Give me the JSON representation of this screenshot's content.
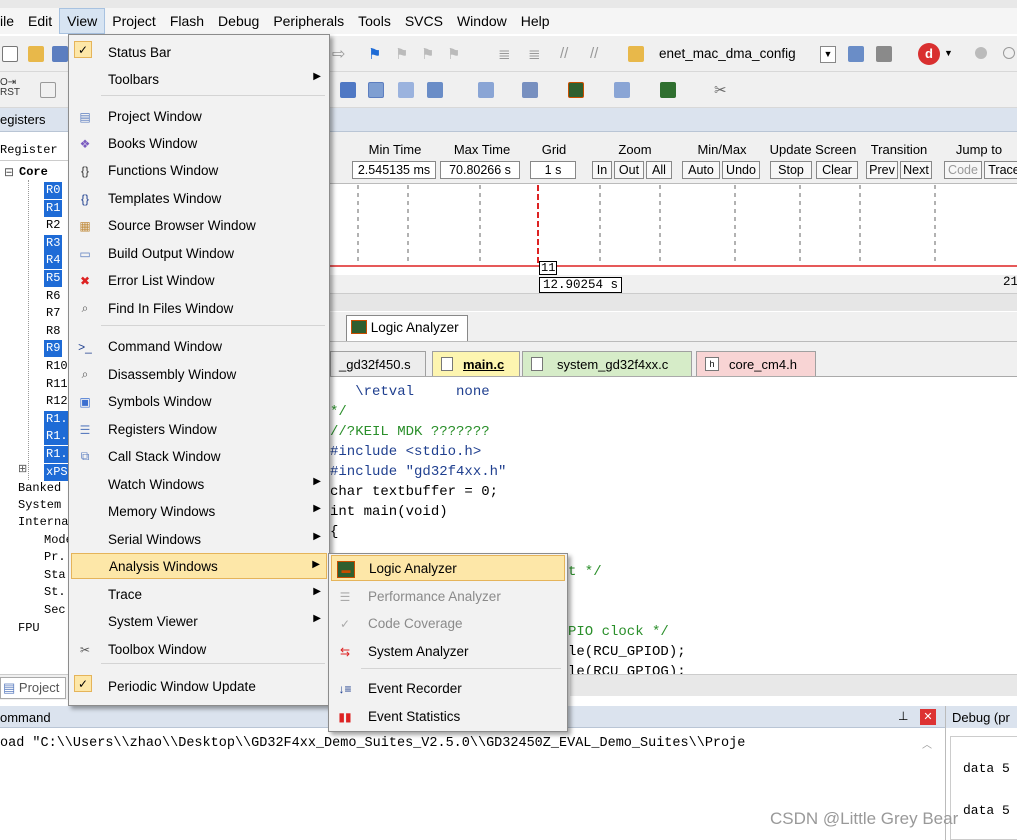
{
  "menubar": {
    "items": [
      "ile",
      "Edit",
      "View",
      "Project",
      "Flash",
      "Debug",
      "Peripherals",
      "Tools",
      "SVCS",
      "Window",
      "Help"
    ]
  },
  "toolbar": {
    "target_name": "enet_mac_dma_config"
  },
  "registers": {
    "panel_title": "egisters",
    "col_header": "Register",
    "core_label": "Core",
    "items": [
      {
        "name": "R0",
        "selected": true
      },
      {
        "name": "R1",
        "selected": true
      },
      {
        "name": "R2",
        "selected": false
      },
      {
        "name": "R3",
        "selected": true
      },
      {
        "name": "R4",
        "selected": true
      },
      {
        "name": "R5",
        "selected": true
      },
      {
        "name": "R6",
        "selected": false
      },
      {
        "name": "R7",
        "selected": false
      },
      {
        "name": "R8",
        "selected": false
      },
      {
        "name": "R9",
        "selected": true
      },
      {
        "name": "R10",
        "selected": false
      },
      {
        "name": "R11",
        "selected": false
      },
      {
        "name": "R12",
        "selected": false
      },
      {
        "name": "R1.",
        "selected": true
      },
      {
        "name": "R1.",
        "selected": true
      },
      {
        "name": "R1.",
        "selected": true
      },
      {
        "name": "xPS",
        "selected": true
      }
    ],
    "tree": [
      "Banked",
      "System",
      "Interna",
      "Mode",
      "Pr.",
      "Sta",
      "St.",
      "Sec",
      "FPU"
    ],
    "tab_label": "Project"
  },
  "logic_analyzer": {
    "min_time_label": "Min Time",
    "min_time_value": "2.545135 ms",
    "max_time_label": "Max Time",
    "max_time_value": "70.80266 s",
    "grid_label": "Grid",
    "grid_value": "1 s",
    "zoom_label": "Zoom",
    "zoom_buttons": [
      "In",
      "Out",
      "All"
    ],
    "minmax_label": "Min/Max",
    "minmax_buttons": [
      "Auto",
      "Undo"
    ],
    "update_label": "Update Screen",
    "update_buttons": [
      "Stop",
      "Clear"
    ],
    "transition_label": "Transition",
    "transition_buttons": [
      "Prev",
      "Next"
    ],
    "jump_label": "Jump to",
    "jump_buttons": [
      "Code",
      "Trace"
    ],
    "signal_value": "11",
    "cursor_time": "12.90254 s",
    "right_label": "21",
    "tab_label": "Logic Analyzer"
  },
  "editor": {
    "tabs": [
      "_gd32f450.s",
      "main.c",
      "system_gd32f4xx.c",
      "core_cm4.h"
    ],
    "lines": [
      "   \\retval     none",
      "*/",
      "//?KEIL MDK ???????",
      "#include <stdio.h>",
      "#include \"gd32f4xx.h\"",
      "char textbuffer = 0;",
      "int main(void)",
      "{"
    ],
    "frag_lines": [
      "t */",
      "",
      "PIO clock */",
      "le(RCU_GPIOD);",
      "le(RCU_GPIOG);"
    ]
  },
  "command": {
    "title": "ommand",
    "text": "oad \"C:\\\\Users\\\\zhao\\\\Desktop\\\\GD32F4xx_Demo_Suites_V2.5.0\\\\GD32450Z_EVAL_Demo_Suites\\\\Proje"
  },
  "debug_panel": {
    "title": "Debug (pr",
    "lines": [
      "data 5",
      "data 5"
    ]
  },
  "view_menu": {
    "items": [
      {
        "label": "Status Bar",
        "icon": "check-icon",
        "checked": true,
        "submenu": false
      },
      {
        "label": "Toolbars",
        "icon": "",
        "submenu": true
      },
      {
        "label": "Project Window",
        "icon": "project-window-icon",
        "submenu": false
      },
      {
        "label": "Books Window",
        "icon": "books-icon",
        "submenu": false
      },
      {
        "label": "Functions Window",
        "icon": "functions-icon",
        "submenu": false
      },
      {
        "label": "Templates Window",
        "icon": "templates-icon",
        "submenu": false
      },
      {
        "label": "Source Browser Window",
        "icon": "source-browser-icon",
        "submenu": false
      },
      {
        "label": "Build Output Window",
        "icon": "build-output-icon",
        "submenu": false
      },
      {
        "label": "Error List Window",
        "icon": "error-icon",
        "submenu": false
      },
      {
        "label": "Find In Files Window",
        "icon": "find-files-icon",
        "submenu": false
      },
      {
        "label": "Command Window",
        "icon": "command-icon",
        "submenu": false
      },
      {
        "label": "Disassembly Window",
        "icon": "disassembly-icon",
        "submenu": false
      },
      {
        "label": "Symbols Window",
        "icon": "symbols-icon",
        "submenu": false
      },
      {
        "label": "Registers Window",
        "icon": "registers-icon",
        "submenu": false
      },
      {
        "label": "Call Stack Window",
        "icon": "call-stack-icon",
        "submenu": false
      },
      {
        "label": "Watch Windows",
        "icon": "",
        "submenu": true
      },
      {
        "label": "Memory Windows",
        "icon": "",
        "submenu": true
      },
      {
        "label": "Serial Windows",
        "icon": "",
        "submenu": true
      },
      {
        "label": "Analysis Windows",
        "icon": "",
        "submenu": true,
        "highlighted": true
      },
      {
        "label": "Trace",
        "icon": "",
        "submenu": true
      },
      {
        "label": "System Viewer",
        "icon": "",
        "submenu": true
      },
      {
        "label": "Toolbox Window",
        "icon": "toolbox-icon",
        "submenu": false
      },
      {
        "label": "Periodic Window Update",
        "icon": "check-icon",
        "checked": true,
        "submenu": false
      }
    ]
  },
  "analysis_submenu": {
    "items": [
      {
        "label": "Logic Analyzer",
        "icon": "logic-analyzer-icon",
        "highlighted": true,
        "disabled": false
      },
      {
        "label": "Performance Analyzer",
        "icon": "performance-analyzer-icon",
        "disabled": true
      },
      {
        "label": "Code Coverage",
        "icon": "code-coverage-icon",
        "disabled": true
      },
      {
        "label": "System Analyzer",
        "icon": "system-analyzer-icon",
        "disabled": false
      },
      {
        "label": "Event Recorder",
        "icon": "event-recorder-icon",
        "disabled": false
      },
      {
        "label": "Event Statistics",
        "icon": "event-statistics-icon",
        "disabled": false
      }
    ]
  },
  "watermark": "CSDN @Little Grey Bear"
}
